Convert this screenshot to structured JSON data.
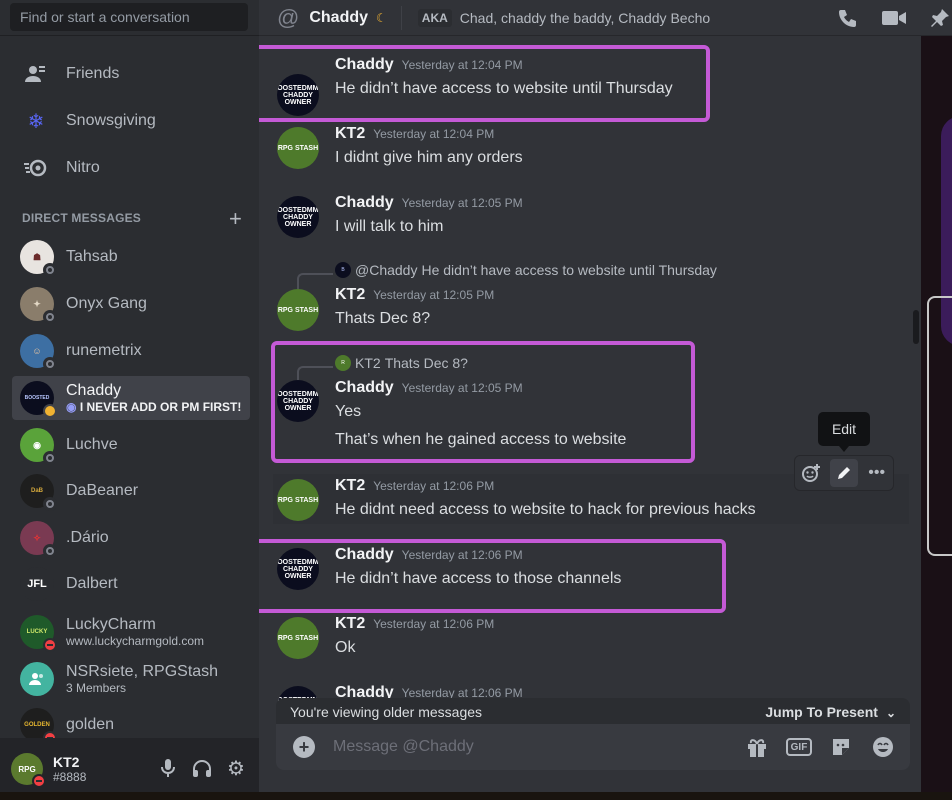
{
  "search": {
    "placeholder": "Find or start a conversation"
  },
  "nav": [
    {
      "label": "Friends",
      "icon": "friends-icon"
    },
    {
      "label": "Snowsgiving",
      "icon": "snowflake-icon"
    },
    {
      "label": "Nitro",
      "icon": "nitro-icon"
    }
  ],
  "dm_header": "Direct Messages",
  "dms": [
    {
      "name": "Tahsab",
      "sub": "",
      "status": "offline"
    },
    {
      "name": "Onyx Gang",
      "sub": "",
      "status": "offline"
    },
    {
      "name": "runemetrix",
      "sub": "",
      "status": "offline"
    },
    {
      "name": "Chaddy",
      "sub": "I NEVER ADD OR PM FIRST!",
      "status": "idle"
    },
    {
      "name": "Luchve",
      "sub": "",
      "status": "offline"
    },
    {
      "name": "DaBeaner",
      "sub": "",
      "status": "offline"
    },
    {
      "name": ".Dário",
      "sub": "",
      "status": "offline"
    },
    {
      "name": "Dalbert",
      "sub": "",
      "status": "offline"
    },
    {
      "name": "LuckyCharm",
      "sub": "www.luckycharmgold.com",
      "status": "dnd"
    },
    {
      "name": "NSRsiete, RPGStash",
      "sub": "3 Members",
      "status": "group"
    },
    {
      "name": "golden",
      "sub": "",
      "status": "offline"
    }
  ],
  "user": {
    "name": "KT2",
    "tag": "#8888"
  },
  "header": {
    "title": "Chaddy",
    "aka_label": "AKA",
    "aka_value": "Chad, chaddy the baddy, Chaddy Becho"
  },
  "messages": [
    {
      "author": "Chaddy",
      "time": "Yesterday at 12:04 PM",
      "lines": [
        "He didn’t have access to website until Thursday"
      ]
    },
    {
      "author": "KT2",
      "time": "Yesterday at 12:04 PM",
      "lines": [
        "I didnt give him any orders"
      ]
    },
    {
      "author": "Chaddy",
      "time": "Yesterday at 12:05 PM",
      "lines": [
        "I will talk to him"
      ]
    },
    {
      "author": "KT2",
      "time": "Yesterday at 12:05 PM",
      "lines": [
        "Thats Dec 8?"
      ],
      "reply_name": "@Chaddy",
      "reply_text": "He didn’t have access to website until Thursday"
    },
    {
      "author": "Chaddy",
      "time": "Yesterday at 12:05 PM",
      "lines": [
        "Yes",
        "That’s when he gained access to website"
      ],
      "reply_name": "KT2",
      "reply_text": "Thats Dec 8?"
    },
    {
      "author": "KT2",
      "time": "Yesterday at 12:06 PM",
      "lines": [
        "He didnt need access to website to hack for previous hacks"
      ]
    },
    {
      "author": "Chaddy",
      "time": "Yesterday at 12:06 PM",
      "lines": [
        "He didn’t have access to those channels"
      ]
    },
    {
      "author": "KT2",
      "time": "Yesterday at 12:06 PM",
      "lines": [
        "Ok"
      ]
    },
    {
      "author": "Chaddy",
      "time": "Yesterday at 12:06 PM",
      "lines": []
    }
  ],
  "avatar_text": {
    "chaddy": "BOOSTEDMMO CHADDY OWNER",
    "kt2": "RPG STASH"
  },
  "tooltip": "Edit",
  "older_banner": {
    "text": "You're viewing older messages",
    "jump": "Jump To Present"
  },
  "composer": {
    "placeholder": "Message @Chaddy",
    "gif": "GIF"
  },
  "colors": {
    "highlight": "#c45ad6",
    "idle": "#f0b232",
    "dnd": "#f23f43"
  }
}
